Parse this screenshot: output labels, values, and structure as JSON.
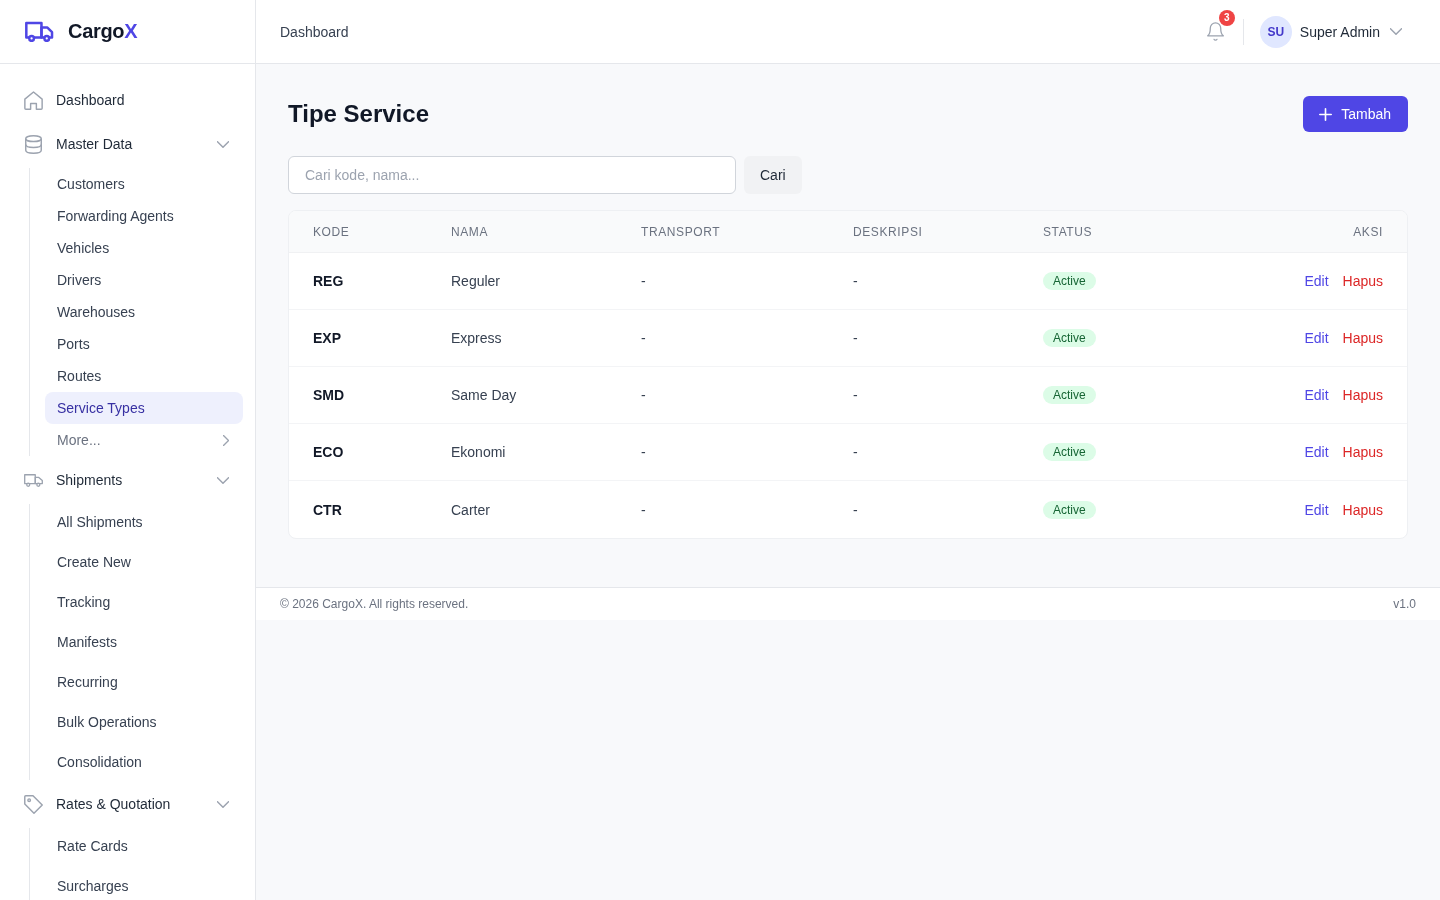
{
  "brand": {
    "name": "Cargo",
    "accent": "X"
  },
  "sidebar": {
    "items": [
      {
        "kind": "link",
        "label": "Dashboard",
        "selected": false
      },
      {
        "kind": "group",
        "label": "Master Data",
        "expanded": true,
        "children": [
          {
            "kind": "link",
            "label": "Customers",
            "selected": false
          },
          {
            "kind": "link",
            "label": "Forwarding Agents",
            "selected": false
          },
          {
            "kind": "link",
            "label": "Vehicles",
            "selected": false
          },
          {
            "kind": "link",
            "label": "Drivers",
            "selected": false
          },
          {
            "kind": "link",
            "label": "Warehouses",
            "selected": false
          },
          {
            "kind": "link",
            "label": "Ports",
            "selected": false
          },
          {
            "kind": "link",
            "label": "Routes",
            "selected": false
          },
          {
            "kind": "link",
            "label": "Service Types",
            "selected": true
          },
          {
            "kind": "more",
            "label": "More...",
            "selected": false
          }
        ]
      },
      {
        "kind": "group",
        "label": "Shipments",
        "expanded": true,
        "children": [
          {
            "kind": "link",
            "label": "All Shipments",
            "selected": false
          },
          {
            "kind": "link",
            "label": "Create New",
            "selected": false
          },
          {
            "kind": "link",
            "label": "Tracking",
            "selected": false
          },
          {
            "kind": "link",
            "label": "Manifests",
            "selected": false
          },
          {
            "kind": "link",
            "label": "Recurring",
            "selected": false
          },
          {
            "kind": "link",
            "label": "Bulk Operations",
            "selected": false
          },
          {
            "kind": "link",
            "label": "Consolidation",
            "selected": false
          }
        ]
      },
      {
        "kind": "group",
        "label": "Rates & Quotation",
        "expanded": true,
        "children": [
          {
            "kind": "link",
            "label": "Rate Cards",
            "selected": false
          },
          {
            "kind": "link",
            "label": "Surcharges",
            "selected": false
          }
        ]
      }
    ]
  },
  "header": {
    "breadcrumb": "Dashboard",
    "notifications": "3",
    "user": {
      "initials": "SU",
      "name": "Super Admin"
    }
  },
  "page": {
    "title": "Tipe Service",
    "add_button": "Tambah"
  },
  "search": {
    "placeholder": "Cari kode, nama...",
    "button": "Cari"
  },
  "table": {
    "columns": [
      "KODE",
      "NAMA",
      "TRANSPORT",
      "DESKRIPSI",
      "STATUS",
      "AKSI"
    ],
    "rows": [
      {
        "kode": "REG",
        "nama": "Reguler",
        "transport": "-",
        "deskripsi": "-",
        "status": "Active",
        "actions": [
          {
            "kind": "edit",
            "label": "Edit"
          },
          {
            "kind": "delete",
            "label": "Hapus"
          }
        ]
      },
      {
        "kode": "EXP",
        "nama": "Express",
        "transport": "-",
        "deskripsi": "-",
        "status": "Active",
        "actions": [
          {
            "kind": "edit",
            "label": "Edit"
          },
          {
            "kind": "delete",
            "label": "Hapus"
          }
        ]
      },
      {
        "kode": "SMD",
        "nama": "Same Day",
        "transport": "-",
        "deskripsi": "-",
        "status": "Active",
        "actions": [
          {
            "kind": "edit",
            "label": "Edit"
          },
          {
            "kind": "delete",
            "label": "Hapus"
          }
        ]
      },
      {
        "kode": "ECO",
        "nama": "Ekonomi",
        "transport": "-",
        "deskripsi": "-",
        "status": "Active",
        "actions": [
          {
            "kind": "edit",
            "label": "Edit"
          },
          {
            "kind": "delete",
            "label": "Hapus"
          }
        ]
      },
      {
        "kode": "CTR",
        "nama": "Carter",
        "transport": "-",
        "deskripsi": "-",
        "status": "Active",
        "actions": [
          {
            "kind": "edit",
            "label": "Edit"
          },
          {
            "kind": "delete",
            "label": "Hapus"
          }
        ]
      }
    ]
  },
  "footer": {
    "copyright": "© 2026 CargoX. All rights reserved.",
    "version": "v1.0"
  }
}
